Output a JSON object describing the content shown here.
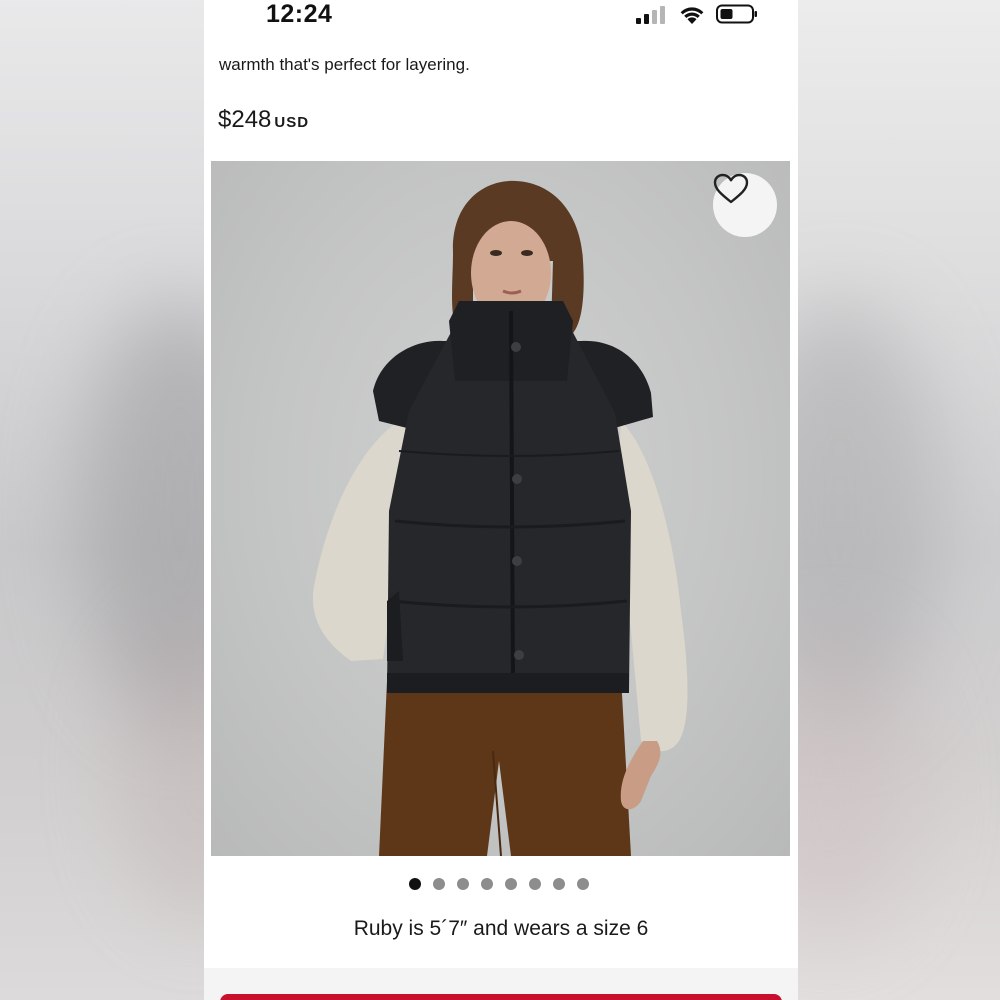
{
  "status_bar": {
    "time": "12:24"
  },
  "product": {
    "description_fragment": "warmth that's perfect for layering.",
    "price_amount": "$248",
    "price_currency": "USD",
    "model_caption": "Ruby is 5´7″ and wears a size 6"
  },
  "gallery": {
    "image_count": 8,
    "active_index": 0,
    "wishlist_icon": "heart-icon"
  },
  "colors": {
    "accent": "#c8102e",
    "active_dot": "#111111",
    "inactive_dot": "#8d8d8d"
  }
}
